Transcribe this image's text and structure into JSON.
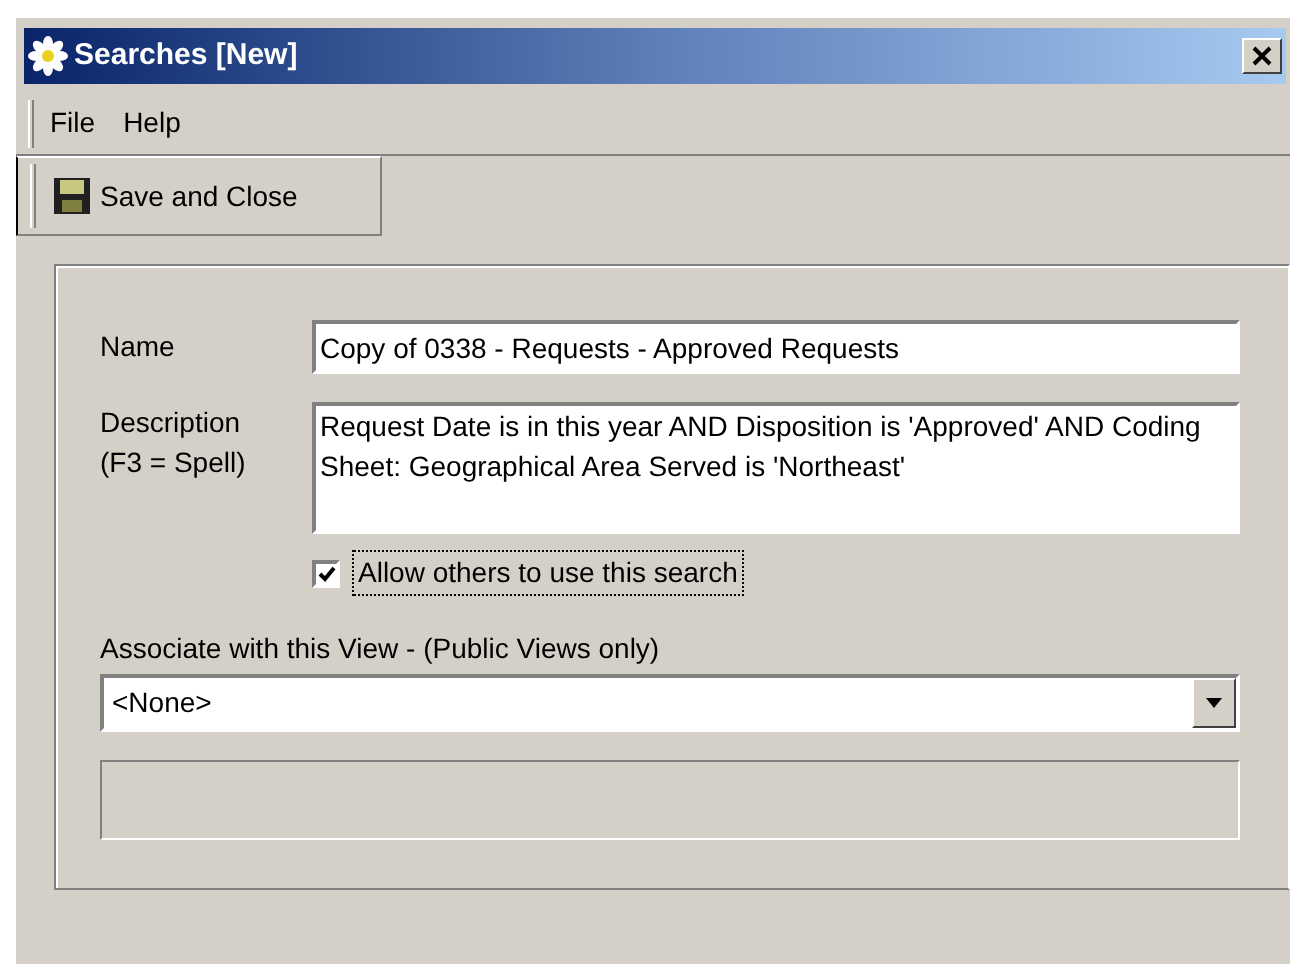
{
  "window": {
    "title": "Searches [New]"
  },
  "menu": [
    "File",
    "Help"
  ],
  "toolbar": {
    "button": "Save and Close"
  },
  "form": {
    "name_label": "Name",
    "name_value": "Copy of 0338 - Requests - Approved Requests",
    "description_label": "Description",
    "description_hint": "(F3 = Spell)",
    "description_value": "Request Date is in this year AND Disposition is 'Approved' AND Coding Sheet: Geographical Area Served is 'Northeast'",
    "allow_others": {
      "label": "Allow others to use this search",
      "checked": true,
      "focused": true
    },
    "view_label": "Associate with this View - (Public Views only)",
    "view_value": "<None>"
  }
}
